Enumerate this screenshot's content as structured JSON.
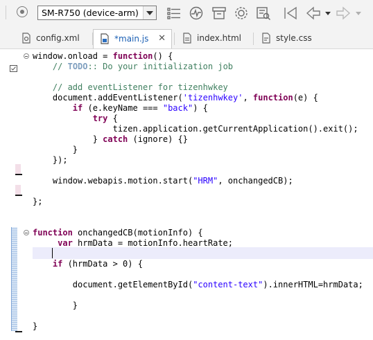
{
  "toolbar": {
    "device": "SM-R750 (device-arm)",
    "icons": [
      "run-config-icon",
      "device-select",
      "list-icon",
      "monitor-icon",
      "package-icon",
      "settings-icon",
      "checklist-icon",
      "back-icon",
      "back-dropdown-icon",
      "forward-icon"
    ]
  },
  "tabs": [
    {
      "label": "config.xml",
      "icon": "config-file-icon",
      "active": false
    },
    {
      "label": "*main.js",
      "icon": "js-file-icon",
      "active": true,
      "close": "✕"
    },
    {
      "label": "index.html",
      "icon": "html-file-icon",
      "active": false
    },
    {
      "label": "style.css",
      "icon": "css-file-icon",
      "active": false
    }
  ],
  "code_lines": [
    "window.onload = function() {",
    "    // TODO:: Do your initialization job",
    "",
    "    // add eventListener for tizenhwkey",
    "    document.addEventListener('tizenhwkey', function(e) {",
    "        if (e.keyName === \"back\") {",
    "            try {",
    "                tizen.application.getCurrentApplication().exit();",
    "            } catch (ignore) {}",
    "        }",
    "    });",
    "",
    "    window.webapis.motion.start(\"HRM\", onchangedCB);",
    "",
    "};",
    "",
    "",
    "function onchangedCB(motionInfo) {",
    "     var hrmData = motionInfo.heartRate;",
    "    ",
    "    if (hrmData > 0) {",
    "",
    "        document.getElementById(\"content-text\").innerHTML=hrmData;",
    "",
    "        }",
    "",
    "}"
  ]
}
